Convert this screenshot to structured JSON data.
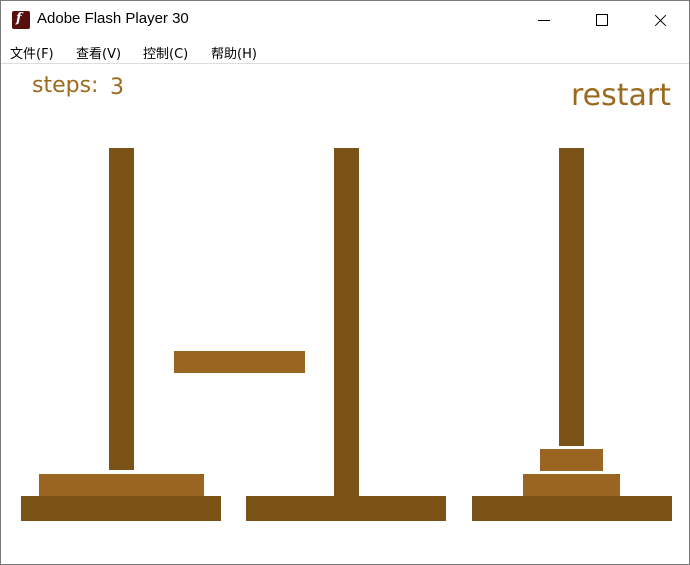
{
  "window": {
    "title": "Adobe Flash Player 30",
    "controls": [
      "minimize",
      "maximize",
      "close"
    ],
    "app_icon": "flash-icon"
  },
  "menu": {
    "items": [
      "文件(F)",
      "查看(V)",
      "控制(C)",
      "帮助(H)"
    ]
  },
  "game": {
    "steps_label": "steps:",
    "steps_value": "3",
    "restart_label": "restart",
    "colors": {
      "peg": "#7a5216",
      "disk": "#9a6520",
      "text": "#9b6a1e"
    },
    "pegs": [
      {
        "index": 1,
        "disks": [
          "large"
        ]
      },
      {
        "index": 2,
        "disks": []
      },
      {
        "index": 3,
        "disks": [
          "medium",
          "small"
        ]
      }
    ],
    "held_disk": "medium-large"
  }
}
